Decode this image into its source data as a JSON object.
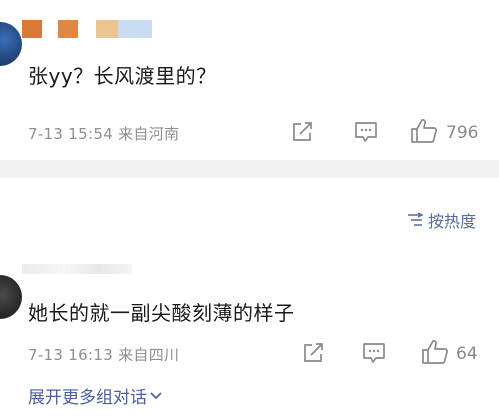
{
  "comment1": {
    "text": "张yy？长风渡里的？",
    "meta": "7-13 15:54  来自河南",
    "likes": "796"
  },
  "sort": {
    "label": "按热度"
  },
  "comment2": {
    "text": "她长的就一副尖酸刻薄的样子",
    "meta": "7-13 16:13  来自四川",
    "likes": "64"
  },
  "expand": {
    "label": "展开更多组对话"
  },
  "icons": {
    "share": "share-icon",
    "comment": "comment-icon",
    "like": "thumbs-up-icon",
    "sort": "sort-icon",
    "chevron": "chevron-down-icon"
  },
  "colors": {
    "link": "#4b5fa0",
    "meta": "#8f8f8f",
    "text": "#1a1a1a",
    "divider": "#f2f2f2"
  }
}
